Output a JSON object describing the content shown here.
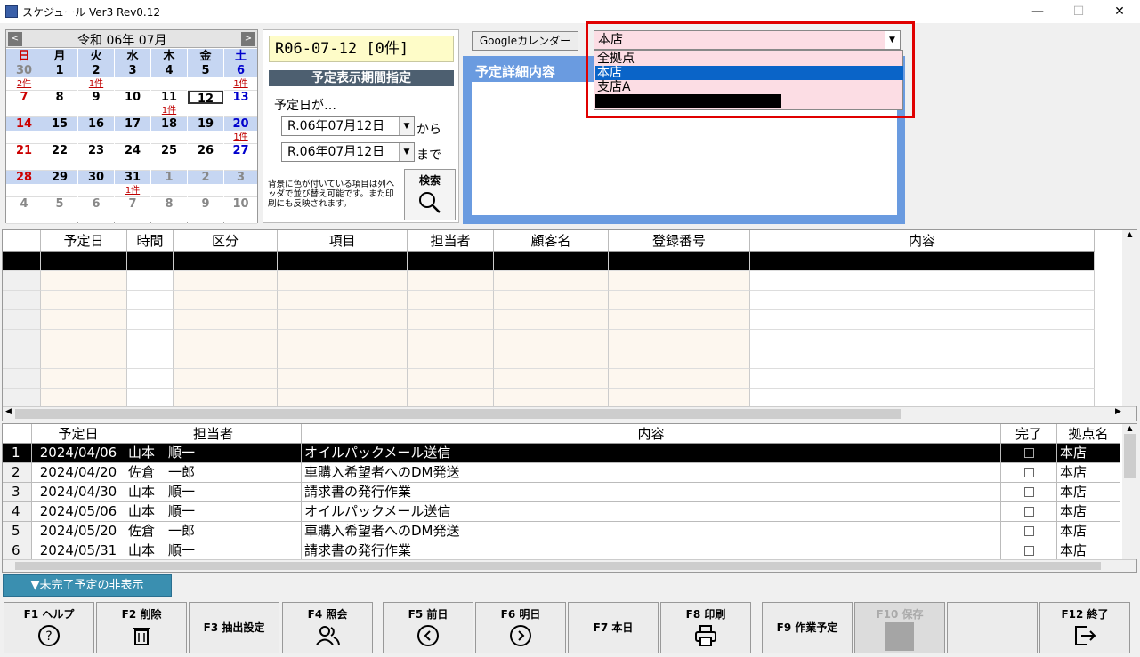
{
  "window": {
    "title": "スケジュール Ver3 Rev0.12",
    "minimize": "—",
    "maximize": "☐",
    "close": "✕"
  },
  "calendar": {
    "month_label": "令和 06年 07月",
    "prev": "<",
    "next": ">",
    "weekdays": [
      "日",
      "月",
      "火",
      "水",
      "木",
      "金",
      "土"
    ],
    "weeks": [
      {
        "days": [
          "30",
          "1",
          "2",
          "3",
          "4",
          "5",
          "6"
        ],
        "badges": [
          "2件",
          "",
          "1件",
          "",
          "",
          "",
          "1件"
        ]
      },
      {
        "days": [
          "7",
          "8",
          "9",
          "10",
          "11",
          "12",
          "13"
        ],
        "badges": [
          "",
          "",
          "",
          "",
          "1件",
          "",
          ""
        ]
      },
      {
        "days": [
          "14",
          "15",
          "16",
          "17",
          "18",
          "19",
          "20"
        ],
        "badges": [
          "",
          "",
          "",
          "",
          "",
          "",
          "1件"
        ]
      },
      {
        "days": [
          "21",
          "22",
          "23",
          "24",
          "25",
          "26",
          "27"
        ],
        "badges": [
          "",
          "",
          "",
          "",
          "",
          "",
          ""
        ]
      },
      {
        "days": [
          "28",
          "29",
          "30",
          "31",
          "1",
          "2",
          "3"
        ],
        "badges": [
          "",
          "",
          "",
          "1件",
          "",
          "",
          ""
        ]
      },
      {
        "days": [
          "4",
          "5",
          "6",
          "7",
          "8",
          "9",
          "10"
        ],
        "badges": [
          "",
          "",
          "",
          "",
          "",
          "",
          ""
        ]
      }
    ]
  },
  "period": {
    "current": "R06-07-12 [0件]",
    "header": "予定表示期間指定",
    "prefix": "予定日が…",
    "from_date": "R.06年07月12日",
    "from_suffix": "から",
    "to_date": "R.06年07月12日",
    "to_suffix": "まで",
    "note": "背景に色が付いている項目は列ヘッダで並び替え可能です。また印刷にも反映されます。",
    "search_label": "検索"
  },
  "google_button": "Googleカレンダー",
  "detail_label": "予定詳細内容",
  "store": {
    "selected": "本店",
    "options": [
      "全拠点",
      "本店",
      "支店A",
      ""
    ]
  },
  "grid1": {
    "headers": [
      "予定日",
      "時間",
      "区分",
      "項目",
      "担当者",
      "顧客名",
      "登録番号",
      "内容"
    ]
  },
  "grid2": {
    "headers": [
      "予定日",
      "担当者",
      "内容",
      "完了",
      "拠点名"
    ],
    "rows": [
      {
        "no": "1",
        "date": "2024/04/06",
        "person": "山本　順一",
        "content": "オイルパックメール送信",
        "store": "本店"
      },
      {
        "no": "2",
        "date": "2024/04/20",
        "person": "佐倉　一郎",
        "content": "車購入希望者へのDM発送",
        "store": "本店"
      },
      {
        "no": "3",
        "date": "2024/04/30",
        "person": "山本　順一",
        "content": "請求書の発行作業",
        "store": "本店"
      },
      {
        "no": "4",
        "date": "2024/05/06",
        "person": "山本　順一",
        "content": "オイルパックメール送信",
        "store": "本店"
      },
      {
        "no": "5",
        "date": "2024/05/20",
        "person": "佐倉　一郎",
        "content": "車購入希望者へのDM発送",
        "store": "本店"
      },
      {
        "no": "6",
        "date": "2024/05/31",
        "person": "山本　順一",
        "content": "請求書の発行作業",
        "store": "本店"
      }
    ]
  },
  "hide_button": "▼未完了予定の非表示",
  "fkeys": [
    {
      "label": "F1 ヘルプ",
      "icon": "help-icon",
      "glyph": "?"
    },
    {
      "label": "F2 削除",
      "icon": "trash-icon",
      "glyph": "🗑"
    },
    {
      "label": "F3 抽出設定",
      "icon": "",
      "glyph": ""
    },
    {
      "label": "F4 照会",
      "icon": "users-icon",
      "glyph": "👥"
    },
    {
      "label": "F5 前日",
      "icon": "arrow-left-icon",
      "glyph": "←"
    },
    {
      "label": "F6 明日",
      "icon": "arrow-right-icon",
      "glyph": "→"
    },
    {
      "label": "F7 本日",
      "icon": "",
      "glyph": ""
    },
    {
      "label": "F8 印刷",
      "icon": "printer-icon",
      "glyph": "🖶"
    },
    {
      "label": "F9 作業予定",
      "icon": "",
      "glyph": ""
    },
    {
      "label": "F10 保存",
      "icon": "save-icon",
      "glyph": ""
    },
    {
      "label": "",
      "icon": "",
      "glyph": ""
    },
    {
      "label": "F12 終了",
      "icon": "exit-icon",
      "glyph": "⇥"
    }
  ]
}
